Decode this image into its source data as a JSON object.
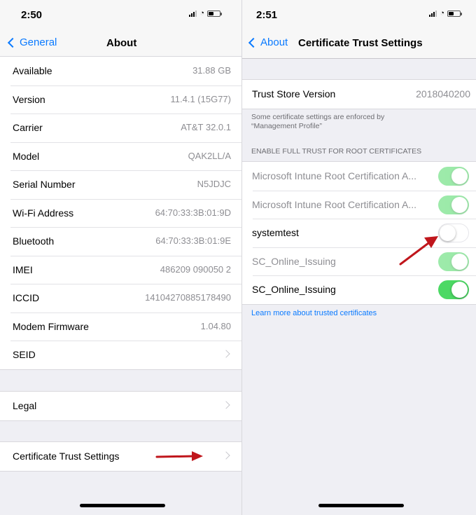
{
  "left": {
    "time": "2:50",
    "back_label": "General",
    "title": "About",
    "rows": [
      {
        "label": "Available",
        "value": "31.88 GB"
      },
      {
        "label": "Version",
        "value": "11.4.1 (15G77)"
      },
      {
        "label": "Carrier",
        "value": "AT&T 32.0.1"
      },
      {
        "label": "Model",
        "value": "QAK2LL/A"
      },
      {
        "label": "Serial Number",
        "value": "N5JDJC"
      },
      {
        "label": "Wi-Fi Address",
        "value": "64:70:33:3B:01:9D"
      },
      {
        "label": "Bluetooth",
        "value": "64:70:33:3B:01:9E"
      },
      {
        "label": "IMEI",
        "value": "486209 090050 2"
      },
      {
        "label": "ICCID",
        "value": "14104270885178490"
      },
      {
        "label": "Modem Firmware",
        "value": "1.04.80"
      },
      {
        "label": "SEID",
        "value": ""
      }
    ],
    "legal_label": "Legal",
    "cert_label": "Certificate Trust Settings"
  },
  "right": {
    "time": "2:51",
    "back_label": "About",
    "title": "Certificate Trust Settings",
    "trust_store": {
      "label": "Trust Store Version",
      "value": "2018040200"
    },
    "enforced_note_line1": "Some certificate settings are enforced by",
    "enforced_note_line2": "“Management Profile”",
    "section_header": "ENABLE FULL TRUST FOR ROOT CERTIFICATES",
    "certs": [
      {
        "label": "Microsoft Intune Root Certification A...",
        "enabled": true,
        "locked": true
      },
      {
        "label": "Microsoft Intune Root Certification A...",
        "enabled": true,
        "locked": true
      },
      {
        "label": "systemtest",
        "enabled": false,
        "locked": false
      },
      {
        "label": "SC_Online_Issuing",
        "enabled": true,
        "locked": true
      },
      {
        "label": "SC_Online_Issuing",
        "enabled": true,
        "locked": false
      }
    ],
    "learn_more": "Learn more about trusted certificates"
  },
  "colors": {
    "accent": "#0a7aff",
    "toggle_on": "#4cd964",
    "annotation_arrow": "#c0161c"
  },
  "icons": [
    "signal-icon",
    "wifi-icon",
    "battery-icon",
    "chevron-left-icon",
    "chevron-right-icon",
    "red-arrow-icon"
  ]
}
